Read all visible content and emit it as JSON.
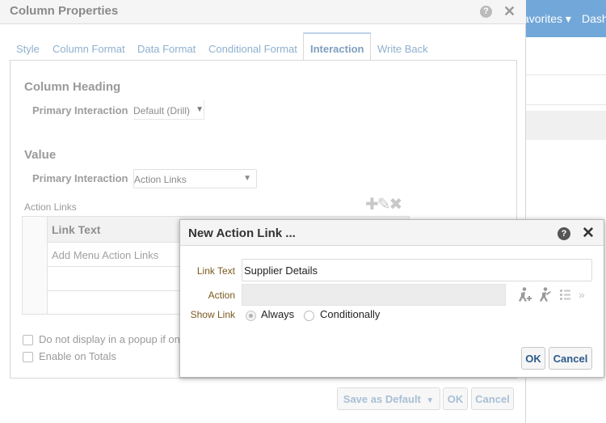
{
  "background": {
    "favorites_label": "avorites ▾",
    "dashboard_label": "Dash"
  },
  "column_properties": {
    "title": "Column Properties",
    "tabs": [
      {
        "label": "Style"
      },
      {
        "label": "Column Format"
      },
      {
        "label": "Data Format"
      },
      {
        "label": "Conditional Format"
      },
      {
        "label": "Interaction",
        "active": true
      },
      {
        "label": "Write Back"
      }
    ],
    "column_heading": {
      "section_title": "Column Heading",
      "primary_interaction_label": "Primary Interaction",
      "primary_interaction_value": "Default (Drill)"
    },
    "value": {
      "section_title": "Value",
      "primary_interaction_label": "Primary Interaction",
      "primary_interaction_value": "Action Links"
    },
    "action_links": {
      "label": "Action Links",
      "table_header": "Link Text",
      "rows": [
        "Add Menu Action Links",
        "",
        ""
      ]
    },
    "options": {
      "no_popup_label": "Do not display in a popup if onl",
      "enable_totals_label": "Enable on Totals"
    },
    "buttons": {
      "save_default": "Save as Default",
      "ok": "OK",
      "cancel": "Cancel"
    }
  },
  "new_action_link": {
    "title": "New Action Link ...",
    "link_text_label": "Link Text",
    "link_text_value": "Supplier Details",
    "action_label": "Action",
    "action_value": "",
    "show_link_label": "Show Link",
    "show_link_options": [
      {
        "label": "Always",
        "selected": true
      },
      {
        "label": "Conditionally",
        "selected": false
      }
    ],
    "ok_label": "OK",
    "cancel_label": "Cancel"
  },
  "colors": {
    "accent_blue": "#72a7d9",
    "button_text": "#2b5a8a",
    "label_brown": "#7a5a1e"
  }
}
